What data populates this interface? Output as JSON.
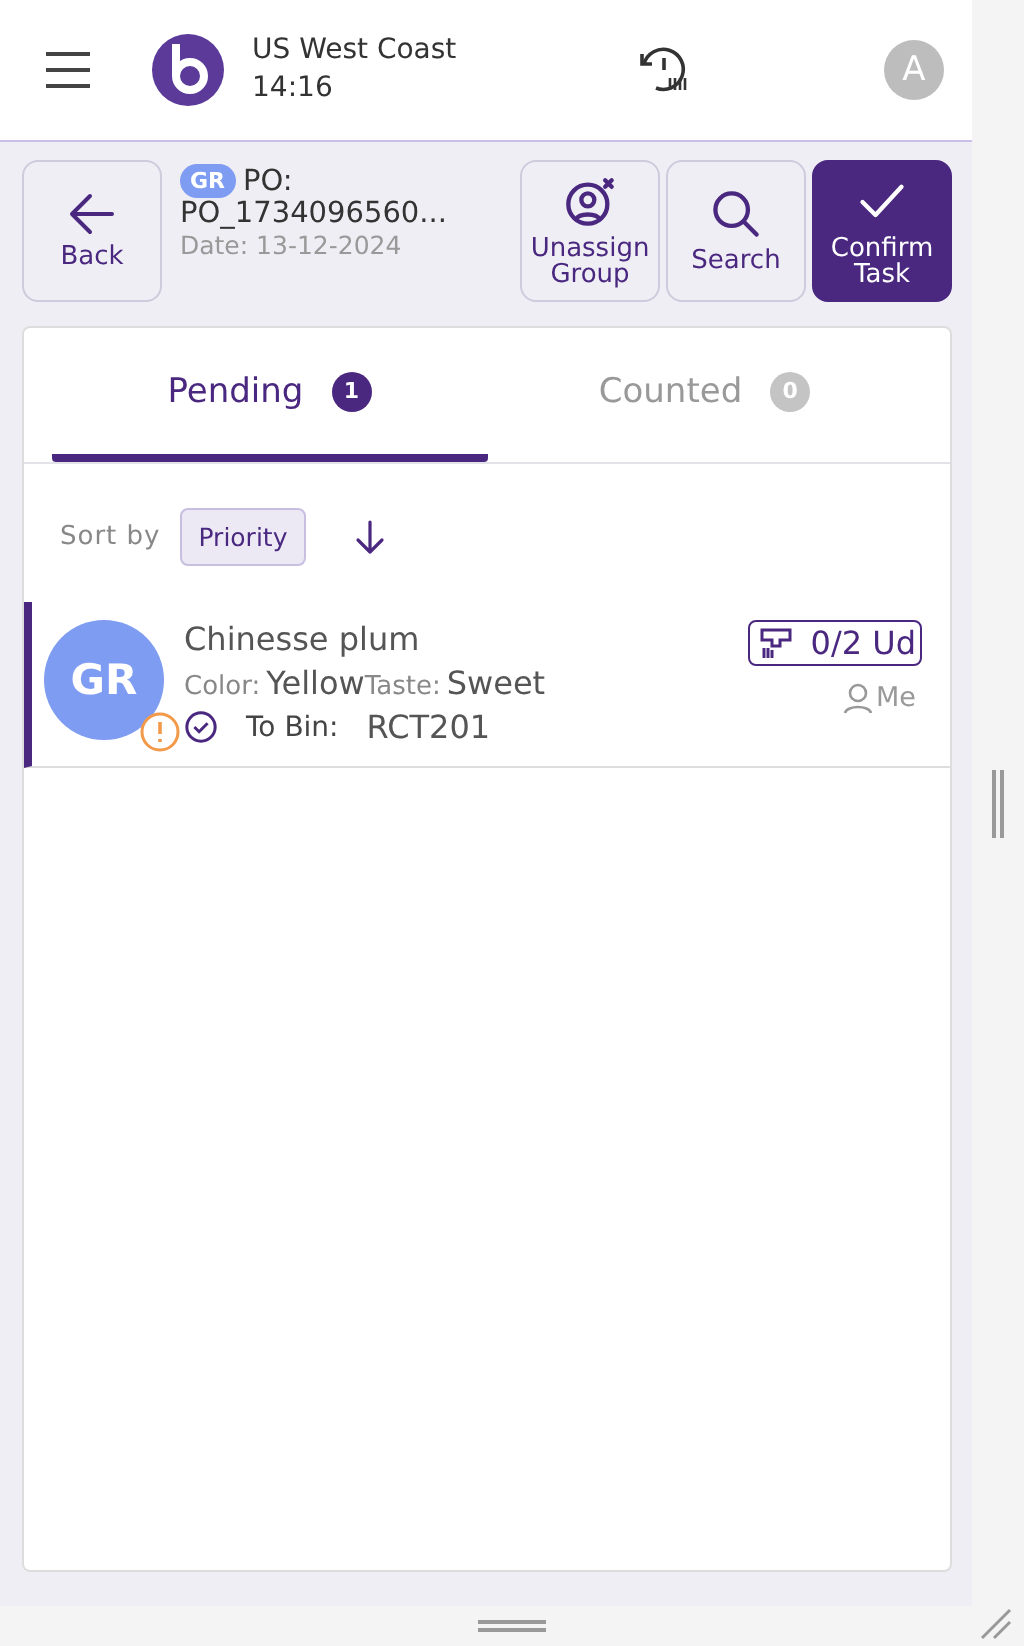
{
  "header": {
    "location": "US West Coast",
    "time": "14:16",
    "avatar": "A"
  },
  "toolbar": {
    "back": "Back",
    "badge": "GR",
    "po_label": "PO:",
    "po_number": "PO_1734096560...",
    "date": "Date: 13-12-2024",
    "actions": [
      {
        "kind": "unassign",
        "label": "Unassign Group"
      },
      {
        "kind": "search",
        "label": "Search"
      },
      {
        "kind": "confirm",
        "label": "Confirm Task"
      }
    ]
  },
  "tabs": [
    {
      "label": "Pending",
      "count": "1",
      "selected": true
    },
    {
      "label": "Counted",
      "count": "0",
      "selected": false
    }
  ],
  "sort": {
    "label": "Sort by",
    "value": "Priority",
    "descending": true
  },
  "items": [
    {
      "avatar": "GR",
      "name": "Chinesse plum",
      "attributes": [
        {
          "label": "Color:",
          "value": "Yellow"
        },
        {
          "label": "Taste:",
          "value": "Sweet"
        }
      ],
      "warning": true,
      "bin_label": "To Bin:",
      "bin": "RCT201",
      "quantity": "0/2 Ud",
      "assignee": "Me"
    }
  ]
}
